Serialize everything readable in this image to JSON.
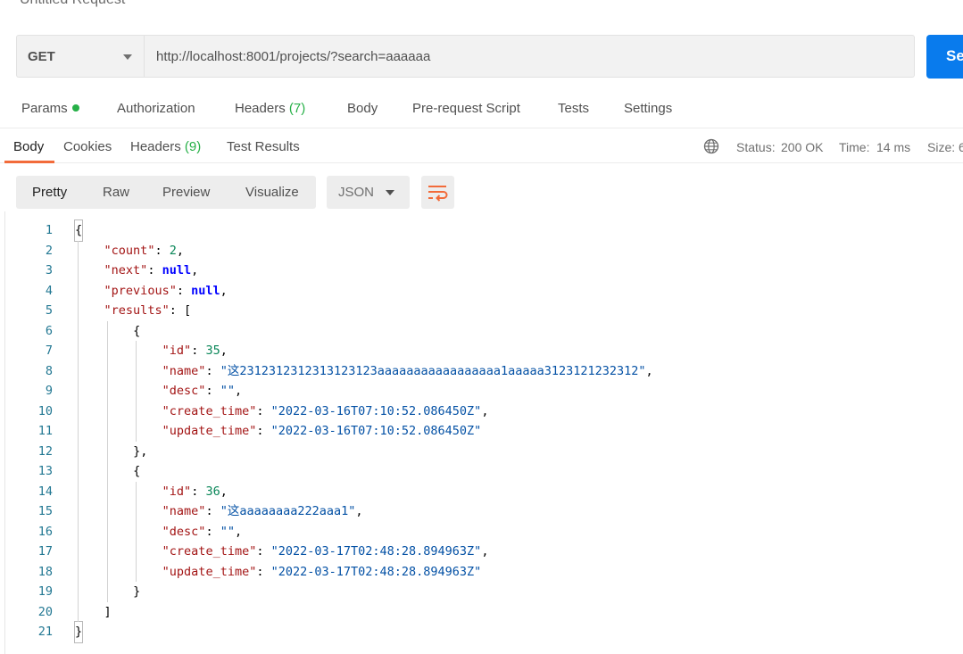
{
  "request": {
    "title": "Untitled Request",
    "method": "GET",
    "url": "http://localhost:8001/projects/?search=aaaaaa",
    "send_label": "Se"
  },
  "request_tabs": [
    {
      "label": "Params",
      "count": ""
    },
    {
      "label": "Authorization",
      "count": ""
    },
    {
      "label": "Headers",
      "count": "(7)"
    },
    {
      "label": "Body",
      "count": ""
    },
    {
      "label": "Pre-request Script",
      "count": ""
    },
    {
      "label": "Tests",
      "count": ""
    },
    {
      "label": "Settings",
      "count": ""
    }
  ],
  "response_tabs": [
    {
      "label": "Body",
      "count": ""
    },
    {
      "label": "Cookies",
      "count": ""
    },
    {
      "label": "Headers",
      "count": "(9)"
    },
    {
      "label": "Test Results",
      "count": ""
    }
  ],
  "status": {
    "status_label": "Status:",
    "status_value": "200 OK",
    "time_label": "Time:",
    "time_value": "14 ms",
    "size_label": "Size:",
    "size_value": "6",
    "icon": "globe-icon"
  },
  "view_tabs": [
    "Pretty",
    "Raw",
    "Preview",
    "Visualize"
  ],
  "format": {
    "selected": "JSON",
    "wrap_icon": "wrap-lines-icon"
  },
  "colors": {
    "accent": "#f26b3a",
    "send": "#097bed",
    "success": "#26b047",
    "json_key": "#a31515",
    "json_string": "#0451a5",
    "json_number": "#098658",
    "json_null": "#0000ff",
    "line_number": "#237893"
  },
  "code_lines": [
    {
      "n": "1",
      "indent": 0,
      "parts": [
        {
          "t": "{",
          "c": "p"
        }
      ]
    },
    {
      "n": "2",
      "indent": 1,
      "parts": [
        {
          "t": "\"count\"",
          "c": "k"
        },
        {
          "t": ": ",
          "c": "p"
        },
        {
          "t": "2",
          "c": "n"
        },
        {
          "t": ",",
          "c": "p"
        }
      ]
    },
    {
      "n": "3",
      "indent": 1,
      "parts": [
        {
          "t": "\"next\"",
          "c": "k"
        },
        {
          "t": ": ",
          "c": "p"
        },
        {
          "t": "null",
          "c": "b"
        },
        {
          "t": ",",
          "c": "p"
        }
      ]
    },
    {
      "n": "4",
      "indent": 1,
      "parts": [
        {
          "t": "\"previous\"",
          "c": "k"
        },
        {
          "t": ": ",
          "c": "p"
        },
        {
          "t": "null",
          "c": "b"
        },
        {
          "t": ",",
          "c": "p"
        }
      ]
    },
    {
      "n": "5",
      "indent": 1,
      "parts": [
        {
          "t": "\"results\"",
          "c": "k"
        },
        {
          "t": ": [",
          "c": "p"
        }
      ]
    },
    {
      "n": "6",
      "indent": 2,
      "parts": [
        {
          "t": "{",
          "c": "p"
        }
      ]
    },
    {
      "n": "7",
      "indent": 3,
      "parts": [
        {
          "t": "\"id\"",
          "c": "k"
        },
        {
          "t": ": ",
          "c": "p"
        },
        {
          "t": "35",
          "c": "n"
        },
        {
          "t": ",",
          "c": "p"
        }
      ]
    },
    {
      "n": "8",
      "indent": 3,
      "parts": [
        {
          "t": "\"name\"",
          "c": "k"
        },
        {
          "t": ": ",
          "c": "p"
        },
        {
          "t": "\"这2312312312313123123aaaaaaaaaaaaaaaaa1aaaaa3123121232312\"",
          "c": "s"
        },
        {
          "t": ",",
          "c": "p"
        }
      ]
    },
    {
      "n": "9",
      "indent": 3,
      "parts": [
        {
          "t": "\"desc\"",
          "c": "k"
        },
        {
          "t": ": ",
          "c": "p"
        },
        {
          "t": "\"\"",
          "c": "s"
        },
        {
          "t": ",",
          "c": "p"
        }
      ]
    },
    {
      "n": "10",
      "indent": 3,
      "parts": [
        {
          "t": "\"create_time\"",
          "c": "k"
        },
        {
          "t": ": ",
          "c": "p"
        },
        {
          "t": "\"2022-03-16T07:10:52.086450Z\"",
          "c": "s"
        },
        {
          "t": ",",
          "c": "p"
        }
      ]
    },
    {
      "n": "11",
      "indent": 3,
      "parts": [
        {
          "t": "\"update_time\"",
          "c": "k"
        },
        {
          "t": ": ",
          "c": "p"
        },
        {
          "t": "\"2022-03-16T07:10:52.086450Z\"",
          "c": "s"
        }
      ]
    },
    {
      "n": "12",
      "indent": 2,
      "parts": [
        {
          "t": "},",
          "c": "p"
        }
      ]
    },
    {
      "n": "13",
      "indent": 2,
      "parts": [
        {
          "t": "{",
          "c": "p"
        }
      ]
    },
    {
      "n": "14",
      "indent": 3,
      "parts": [
        {
          "t": "\"id\"",
          "c": "k"
        },
        {
          "t": ": ",
          "c": "p"
        },
        {
          "t": "36",
          "c": "n"
        },
        {
          "t": ",",
          "c": "p"
        }
      ]
    },
    {
      "n": "15",
      "indent": 3,
      "parts": [
        {
          "t": "\"name\"",
          "c": "k"
        },
        {
          "t": ": ",
          "c": "p"
        },
        {
          "t": "\"这aaaaaaaa222aaa1\"",
          "c": "s"
        },
        {
          "t": ",",
          "c": "p"
        }
      ]
    },
    {
      "n": "16",
      "indent": 3,
      "parts": [
        {
          "t": "\"desc\"",
          "c": "k"
        },
        {
          "t": ": ",
          "c": "p"
        },
        {
          "t": "\"\"",
          "c": "s"
        },
        {
          "t": ",",
          "c": "p"
        }
      ]
    },
    {
      "n": "17",
      "indent": 3,
      "parts": [
        {
          "t": "\"create_time\"",
          "c": "k"
        },
        {
          "t": ": ",
          "c": "p"
        },
        {
          "t": "\"2022-03-17T02:48:28.894963Z\"",
          "c": "s"
        },
        {
          "t": ",",
          "c": "p"
        }
      ]
    },
    {
      "n": "18",
      "indent": 3,
      "parts": [
        {
          "t": "\"update_time\"",
          "c": "k"
        },
        {
          "t": ": ",
          "c": "p"
        },
        {
          "t": "\"2022-03-17T02:48:28.894963Z\"",
          "c": "s"
        }
      ]
    },
    {
      "n": "19",
      "indent": 2,
      "parts": [
        {
          "t": "}",
          "c": "p"
        }
      ]
    },
    {
      "n": "20",
      "indent": 1,
      "parts": [
        {
          "t": "]",
          "c": "p"
        }
      ]
    },
    {
      "n": "21",
      "indent": 0,
      "parts": [
        {
          "t": "}",
          "c": "p"
        }
      ]
    }
  ]
}
